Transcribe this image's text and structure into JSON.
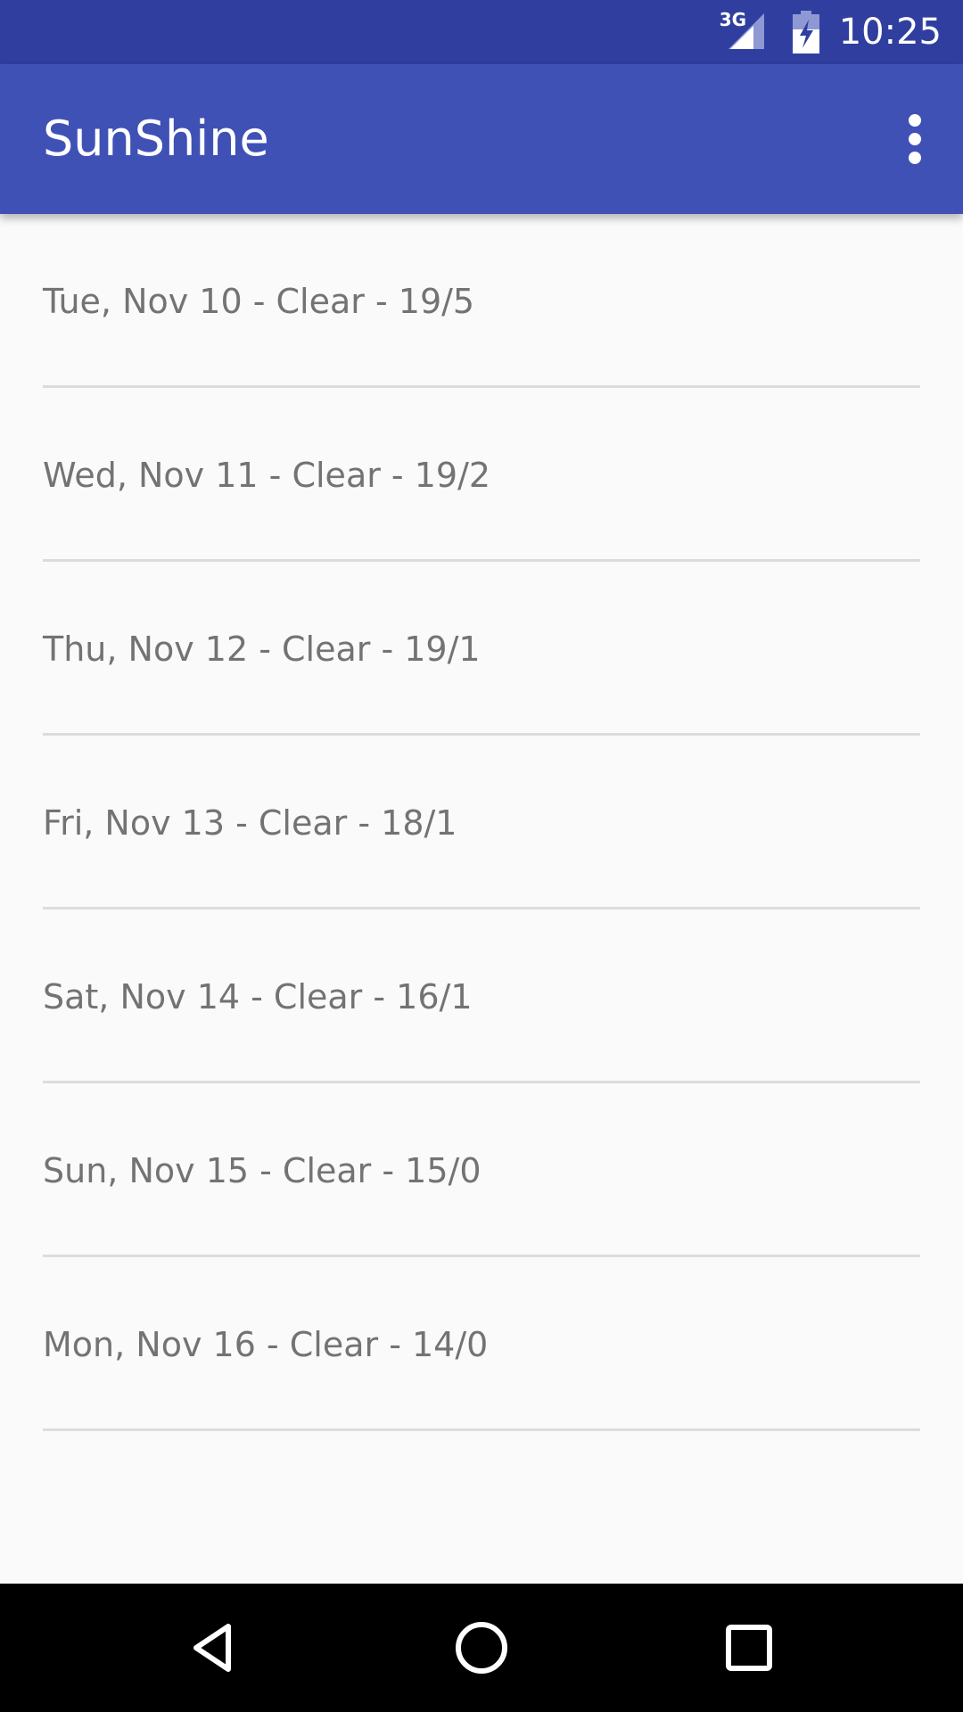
{
  "status_bar": {
    "network": "3G",
    "time": "10:25",
    "icons": [
      "signal-icon",
      "battery-charging-icon"
    ]
  },
  "app_bar": {
    "title": "SunShine",
    "menu_icon": "overflow-menu-icon"
  },
  "forecast": [
    {
      "text": "Tue, Nov 10 - Clear - 19/5"
    },
    {
      "text": "Wed, Nov 11 - Clear - 19/2"
    },
    {
      "text": "Thu, Nov 12 - Clear - 19/1"
    },
    {
      "text": "Fri, Nov 13 - Clear - 18/1"
    },
    {
      "text": "Sat, Nov 14 - Clear - 16/1"
    },
    {
      "text": "Sun, Nov 15 - Clear - 15/0"
    },
    {
      "text": "Mon, Nov 16 - Clear - 14/0"
    }
  ],
  "nav_bar": {
    "icons": [
      "back-icon",
      "home-icon",
      "recents-icon"
    ]
  },
  "colors": {
    "status_bar": "#303f9f",
    "app_bar": "#3f51b5",
    "background": "#fafafa",
    "list_text": "#737373",
    "divider": "#dcdcdc",
    "nav_bar": "#000000"
  }
}
